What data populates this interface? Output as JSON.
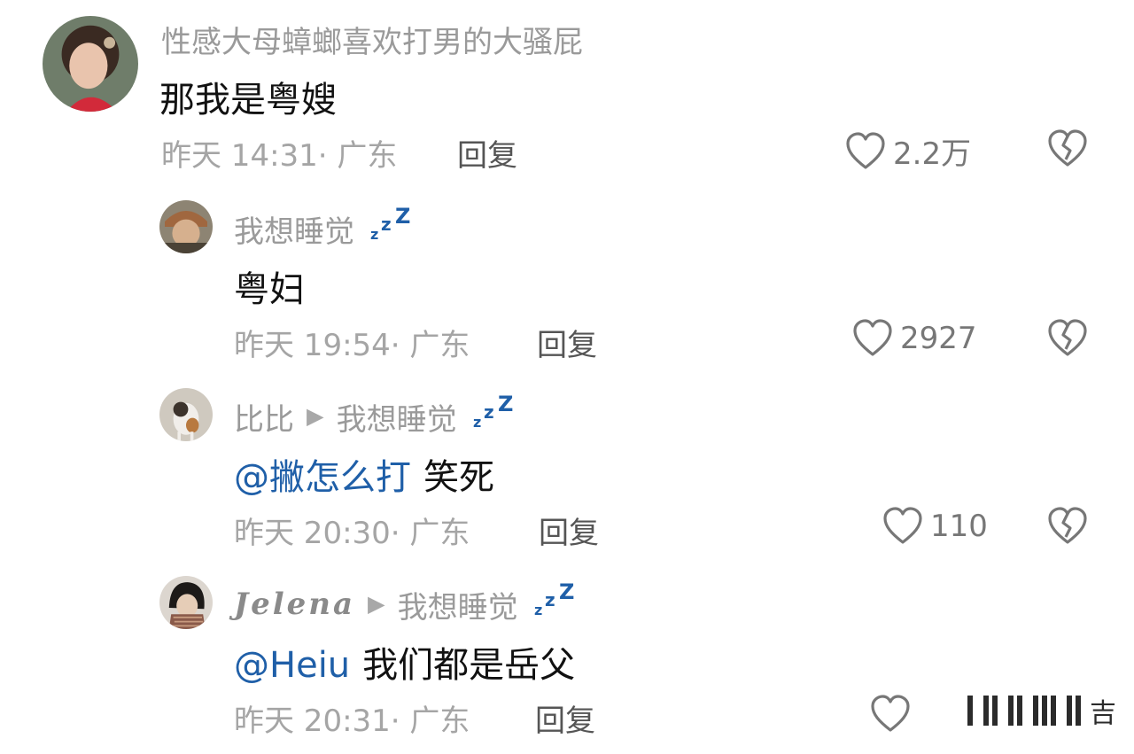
{
  "colors": {
    "mention": "#1f5fa8",
    "meta": "#a5a5a5",
    "author": "#9a9a9a",
    "zzz": "#1f5fa8"
  },
  "comments": [
    {
      "author": "性感大母蟑螂喜欢打男的大骚屁",
      "text": "那我是粤嫂",
      "time_loc": "昨天 14:31· 广东",
      "reply_label": "回复",
      "likes": "2.2万",
      "avatar": "avatar-woman"
    },
    {
      "author": "我想睡觉",
      "badge": "sleep-zzz-icon",
      "text": "粤妇",
      "time_loc": "昨天 19:54· 广东",
      "reply_label": "回复",
      "likes": "2927",
      "avatar": "avatar-child"
    },
    {
      "author": "比比",
      "reply_to": "我想睡觉",
      "badge": "sleep-zzz-icon",
      "mention": "@撇怎么打",
      "text": "笑死",
      "time_loc": "昨天 20:30· 广东",
      "reply_label": "回复",
      "likes": "110",
      "avatar": "avatar-cat"
    },
    {
      "author": "Jelena",
      "reply_to": "我想睡觉",
      "badge": "sleep-zzz-icon",
      "mention": "@Heiu",
      "text": "我们都是岳父",
      "time_loc": "昨天 20:31· 广东",
      "reply_label": "回复",
      "likes": "",
      "avatar": "avatar-person-scarf"
    }
  ],
  "watermark": {
    "text": "吉"
  }
}
